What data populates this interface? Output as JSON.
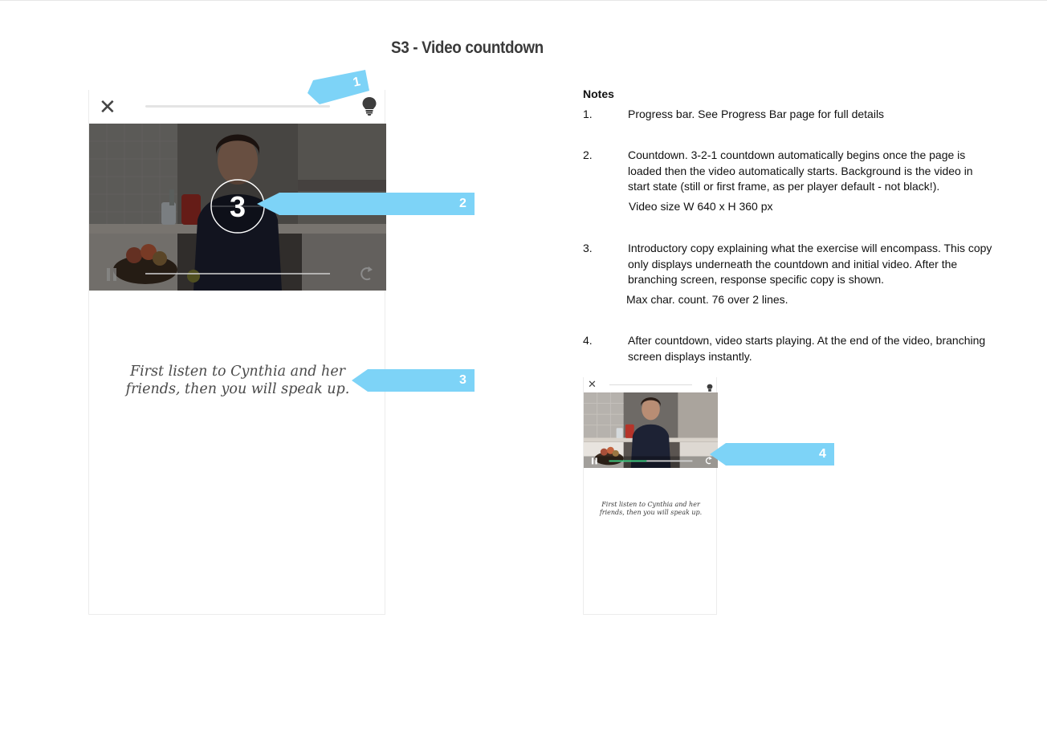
{
  "page": {
    "title": "S3 - Video countdown"
  },
  "phone": {
    "close_glyph": "✕",
    "countdown": "3",
    "progress": 0,
    "intro_line1": "First listen to Cynthia and her",
    "intro_line2": "friends, then you will speak up."
  },
  "phone_small": {
    "close_glyph": "✕",
    "video_progress": 0.45,
    "intro_line1": "First listen to Cynthia and her",
    "intro_line2": "friends, then you will speak up."
  },
  "callouts": [
    "1",
    "2",
    "3",
    "4"
  ],
  "notes": {
    "heading": "Notes",
    "items": [
      {
        "num": "1.",
        "text": "Progress bar. See Progress Bar page for full details",
        "extra": ""
      },
      {
        "num": "2.",
        "text": "Countdown. 3-2-1 countdown automatically begins once the page is loaded then the video automatically starts. Background is the video in start state (still or first frame, as per player default - not black!).",
        "extra": "Video size W 640 x H 360 px"
      },
      {
        "num": "3.",
        "text": "Introductory copy explaining what the exercise will encompass. This copy only displays underneath the countdown and initial video. After the branching screen, response specific copy is shown.",
        "extra": "Max char. count. 76 over 2 lines."
      },
      {
        "num": "4.",
        "text": "After countdown, video starts playing. At the end of the video, branching screen displays instantly.",
        "extra": ""
      }
    ]
  },
  "colors": {
    "callout": "#7dd3f7",
    "progress_played": "#35c77a",
    "text": "#111111"
  },
  "icons": [
    "close-icon",
    "lightbulb-icon",
    "pause-icon",
    "replay-icon"
  ]
}
